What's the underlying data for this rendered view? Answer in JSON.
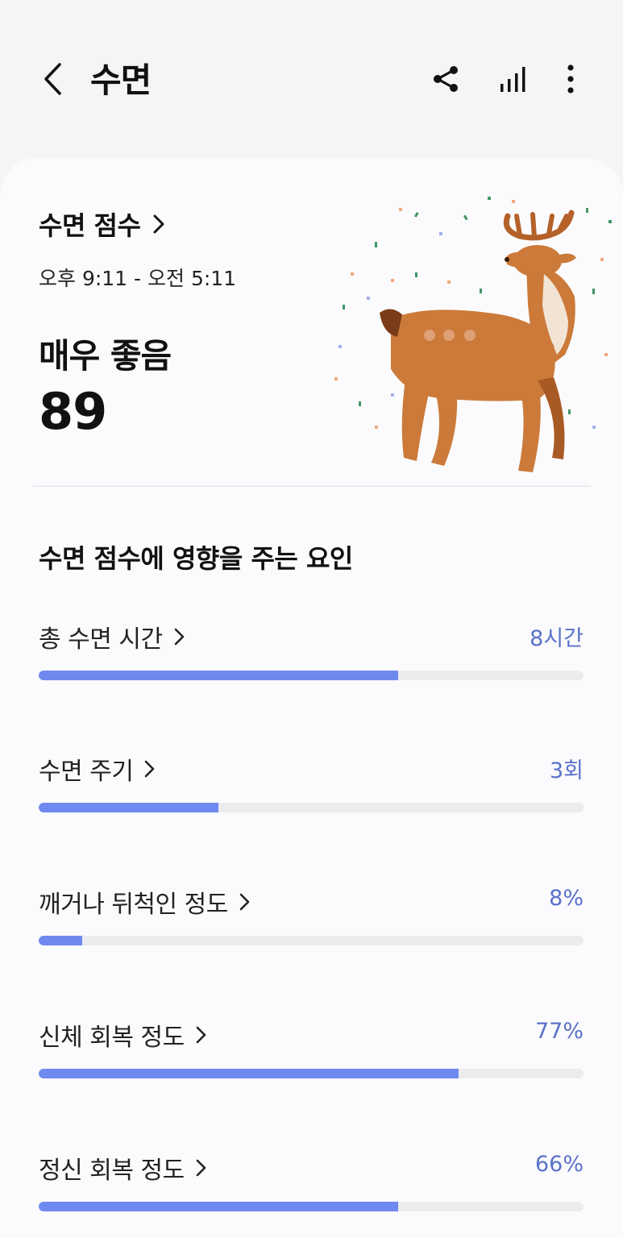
{
  "header": {
    "title": "수면",
    "icons": [
      "back-icon",
      "share-icon",
      "signal-bars-icon",
      "more-vert-icon"
    ]
  },
  "score_card": {
    "title": "수면 점수",
    "time_range": "오후 9:11 - 오전 5:11",
    "grade": "매우 좋음",
    "score": "89",
    "illustration": "deer-confetti-illustration"
  },
  "factors": {
    "heading": "수면 점수에 영향을 주는 요인",
    "items": [
      {
        "label": "총 수면 시간",
        "value": "8시간",
        "progress": 0.66
      },
      {
        "label": "수면 주기",
        "value": "3회",
        "progress": 0.33
      },
      {
        "label": "깨거나 뒤척인 정도",
        "value": "8%",
        "progress": 0.08
      },
      {
        "label": "신체 회복 정도",
        "value": "77%",
        "progress": 0.77
      },
      {
        "label": "정신 회복 정도",
        "value": "66%",
        "progress": 0.66
      }
    ]
  },
  "colors": {
    "accent": "#6e89ef",
    "value_text": "#5a72c8",
    "track": "#ececee"
  }
}
